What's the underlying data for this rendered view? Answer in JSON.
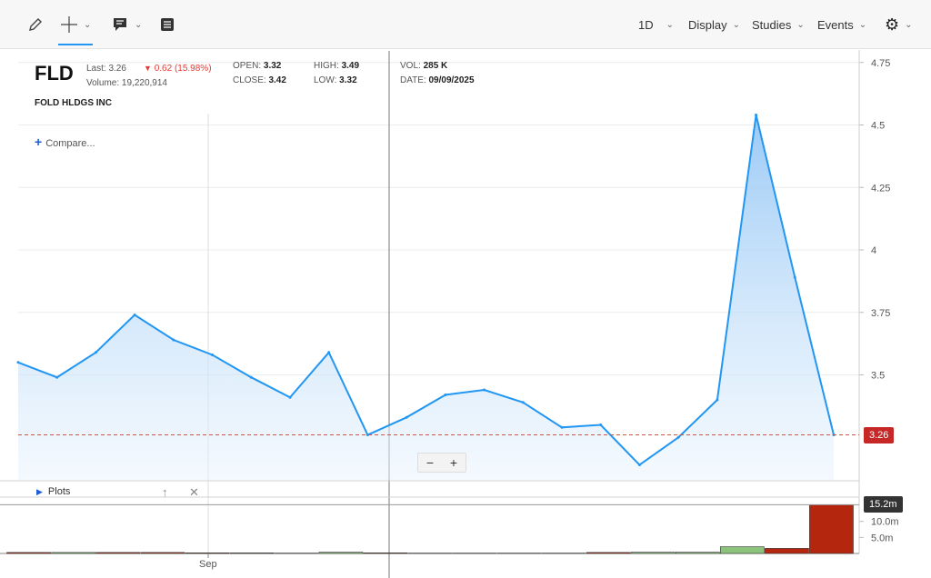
{
  "toolbar": {
    "interval": "1D",
    "display": "Display",
    "studies": "Studies",
    "events": "Events"
  },
  "quote": {
    "symbol": "FLD",
    "last_label": "Last:",
    "last": "3.26",
    "change": "0.62 (15.98%)",
    "volume_label": "Volume:",
    "volume": "19,220,914",
    "company": "FOLD HLDGS INC",
    "open_label": "OPEN:",
    "open": "3.32",
    "close_label": "CLOSE:",
    "close": "3.42",
    "high_label": "HIGH:",
    "high": "3.49",
    "low_label": "LOW:",
    "low": "3.32",
    "vol_label": "VOL:",
    "vol": "285 K",
    "date_label": "DATE:",
    "date": "09/09/2025"
  },
  "compare_label": "Compare...",
  "plots_label": "Plots",
  "colors": {
    "line": "#2196f3",
    "down": "#e53935",
    "price_badge": "#c62828",
    "vol_up": "#8bc37a",
    "vol_down": "#b5260f"
  },
  "chart_data": {
    "type": "line",
    "x_tick_label": "Sep",
    "price": {
      "ylim": [
        3.08,
        4.8
      ],
      "y_ticks": [
        "4.75",
        "4.5",
        "4.25",
        "4",
        "3.75",
        "3.5"
      ],
      "values": [
        3.55,
        3.49,
        3.59,
        3.74,
        3.64,
        3.58,
        3.49,
        3.41,
        3.59,
        3.26,
        3.33,
        3.42,
        3.44,
        3.39,
        3.29,
        3.3,
        3.14,
        3.25,
        3.4,
        4.54,
        3.89,
        3.26
      ],
      "last_price_label": "3.26"
    },
    "volume": {
      "ylim": [
        0,
        17.3
      ],
      "y_ticks": [
        "10.0m",
        "5.0m"
      ],
      "current_label": "15.2m",
      "values": [
        0.3,
        0.3,
        0.3,
        0.3,
        0.2,
        0.2,
        0.1,
        0.4,
        0.2,
        0.1,
        0.1,
        0.1,
        0.1,
        0.3,
        0.4,
        0.4,
        2.1,
        1.6,
        15.2
      ],
      "up": [
        false,
        true,
        false,
        false,
        false,
        true,
        false,
        true,
        false,
        false,
        false,
        false,
        false,
        false,
        true,
        true,
        true,
        false,
        false
      ]
    }
  }
}
